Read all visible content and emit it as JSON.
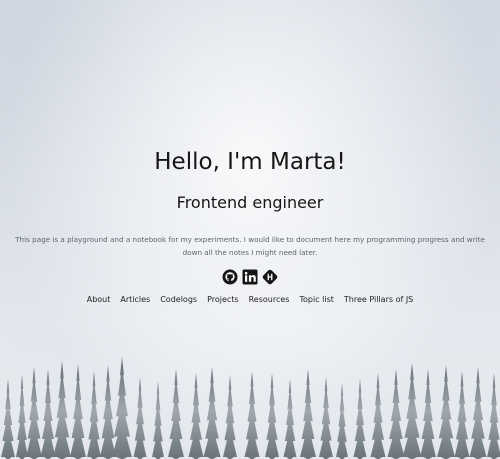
{
  "hero": {
    "title": "Hello, I'm Marta!",
    "subtitle": "Frontend engineer",
    "description": "This page is a playground and a notebook for my experiments. I would like to document here my programming progress and write down all the notes I might need later."
  },
  "socials": [
    {
      "icon": "github-icon"
    },
    {
      "icon": "linkedin-icon"
    },
    {
      "icon": "hashnode-icon"
    }
  ],
  "nav": {
    "items": [
      "About",
      "Articles",
      "Codelogs",
      "Projects",
      "Resources",
      "Topic list",
      "Three Pillars of JS"
    ]
  },
  "colors": {
    "text": "#161616",
    "muted_text": "#5f646c",
    "background": "#e3e7ed",
    "trees": "#2f3a44"
  }
}
